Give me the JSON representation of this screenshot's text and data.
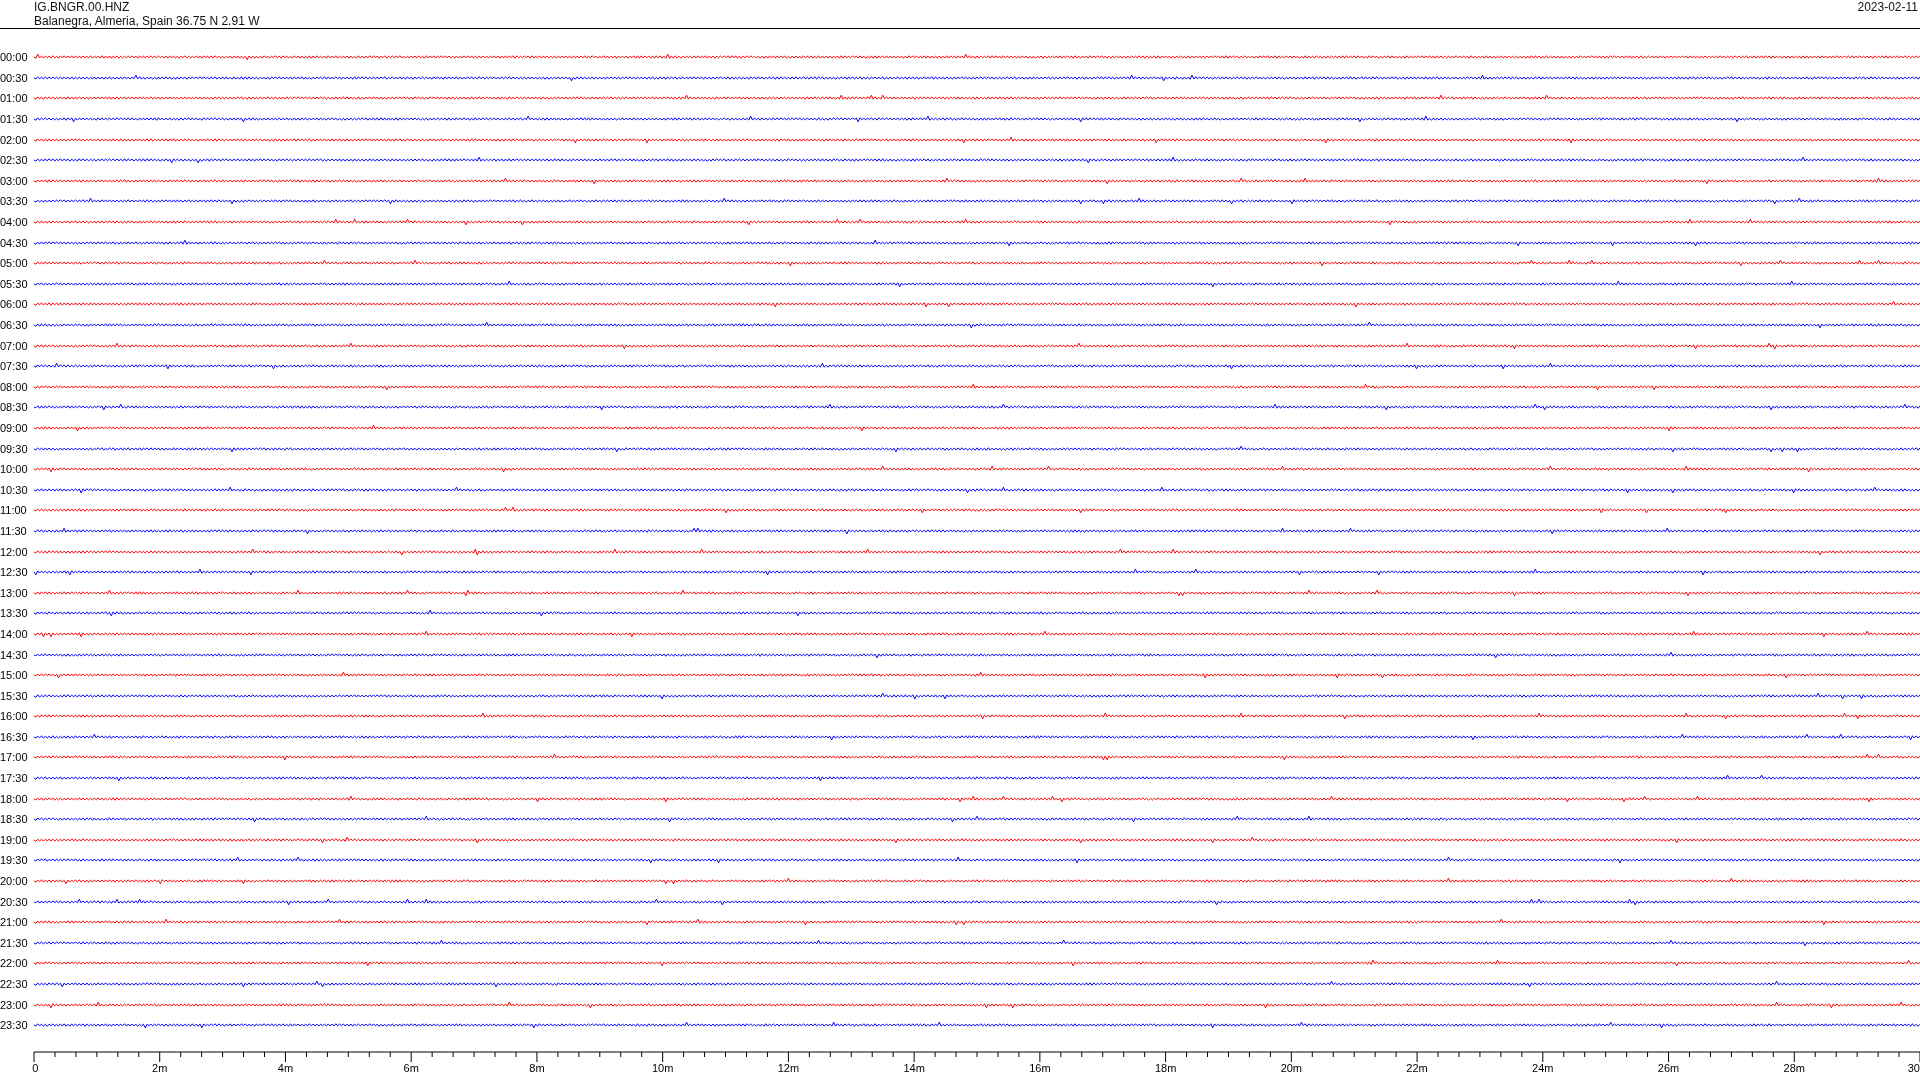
{
  "header": {
    "station": "IG.BNGR.00.HNZ",
    "location": "Balanegra, Almeria, Spain  36.75 N 2.91 W",
    "date": "2023-02-11"
  },
  "traces": [
    {
      "time": "00:00",
      "color": "#ff0000"
    },
    {
      "time": "00:30",
      "color": "#0000ff"
    },
    {
      "time": "01:00",
      "color": "#ff0000"
    },
    {
      "time": "01:30",
      "color": "#0000ff"
    },
    {
      "time": "02:00",
      "color": "#ff0000"
    },
    {
      "time": "02:30",
      "color": "#0000ff"
    },
    {
      "time": "03:00",
      "color": "#ff0000"
    },
    {
      "time": "03:30",
      "color": "#0000ff"
    },
    {
      "time": "04:00",
      "color": "#ff0000"
    },
    {
      "time": "04:30",
      "color": "#0000ff"
    },
    {
      "time": "05:00",
      "color": "#ff0000"
    },
    {
      "time": "05:30",
      "color": "#0000ff"
    },
    {
      "time": "06:00",
      "color": "#ff0000"
    },
    {
      "time": "06:30",
      "color": "#0000ff"
    },
    {
      "time": "07:00",
      "color": "#ff0000"
    },
    {
      "time": "07:30",
      "color": "#0000ff"
    },
    {
      "time": "08:00",
      "color": "#ff0000"
    },
    {
      "time": "08:30",
      "color": "#0000ff"
    },
    {
      "time": "09:00",
      "color": "#ff0000"
    },
    {
      "time": "09:30",
      "color": "#0000ff"
    },
    {
      "time": "10:00",
      "color": "#ff0000"
    },
    {
      "time": "10:30",
      "color": "#0000ff"
    },
    {
      "time": "11:00",
      "color": "#ff0000"
    },
    {
      "time": "11:30",
      "color": "#0000ff"
    },
    {
      "time": "12:00",
      "color": "#ff0000"
    },
    {
      "time": "12:30",
      "color": "#0000ff"
    },
    {
      "time": "13:00",
      "color": "#ff0000"
    },
    {
      "time": "13:30",
      "color": "#0000ff"
    },
    {
      "time": "14:00",
      "color": "#ff0000"
    },
    {
      "time": "14:30",
      "color": "#0000ff"
    },
    {
      "time": "15:00",
      "color": "#ff0000"
    },
    {
      "time": "15:30",
      "color": "#0000ff"
    },
    {
      "time": "16:00",
      "color": "#ff0000"
    },
    {
      "time": "16:30",
      "color": "#0000ff"
    },
    {
      "time": "17:00",
      "color": "#ff0000"
    },
    {
      "time": "17:30",
      "color": "#0000ff"
    },
    {
      "time": "18:00",
      "color": "#ff0000"
    },
    {
      "time": "18:30",
      "color": "#0000ff"
    },
    {
      "time": "19:00",
      "color": "#ff0000"
    },
    {
      "time": "19:30",
      "color": "#0000ff"
    },
    {
      "time": "20:00",
      "color": "#ff0000"
    },
    {
      "time": "20:30",
      "color": "#0000ff"
    },
    {
      "time": "21:00",
      "color": "#ff0000"
    },
    {
      "time": "21:30",
      "color": "#0000ff"
    },
    {
      "time": "22:00",
      "color": "#ff0000"
    },
    {
      "time": "22:30",
      "color": "#0000ff"
    },
    {
      "time": "23:00",
      "color": "#ff0000"
    },
    {
      "time": "23:30",
      "color": "#0000ff"
    }
  ],
  "x_axis": {
    "labels": [
      "0",
      "2m",
      "4m",
      "6m",
      "8m",
      "10m",
      "12m",
      "14m",
      "16m",
      "18m",
      "20m",
      "22m",
      "24m",
      "26m",
      "28m",
      "30"
    ]
  }
}
